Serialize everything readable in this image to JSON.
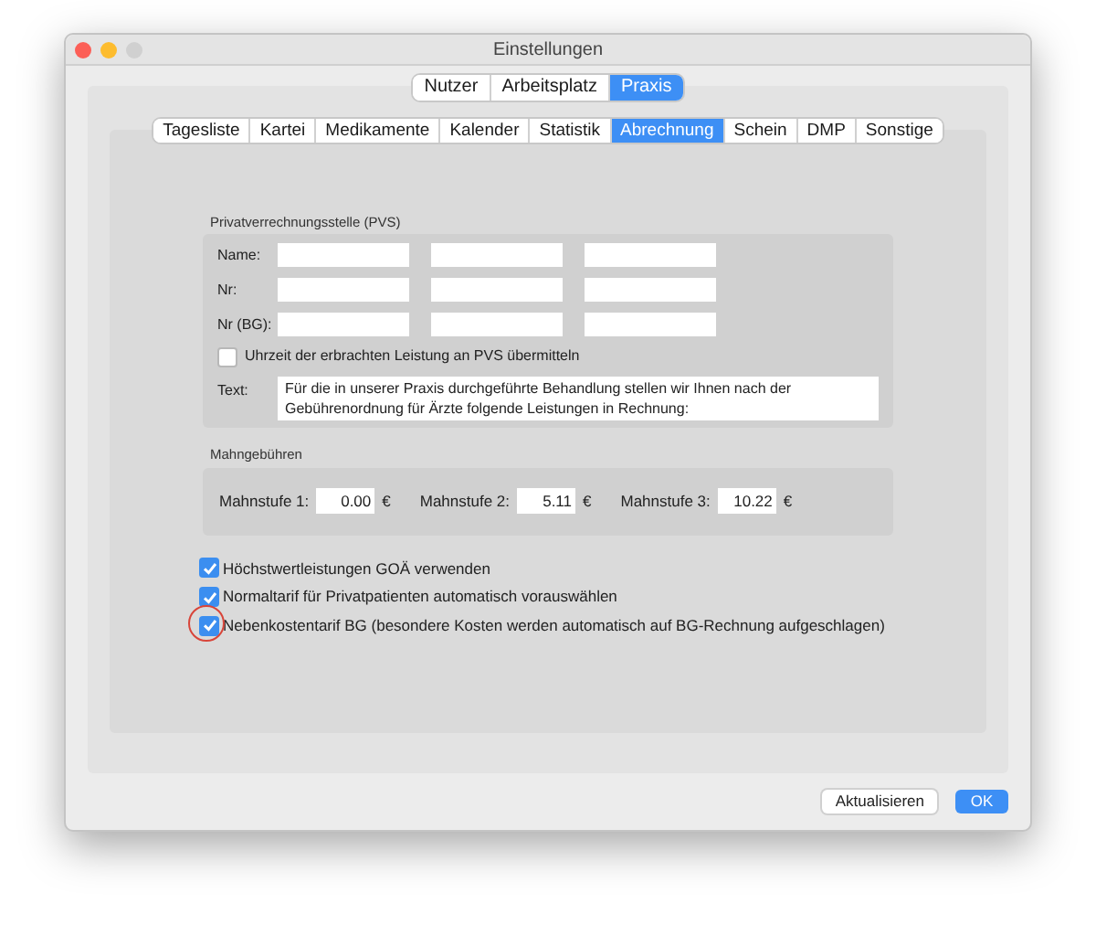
{
  "window": {
    "title": "Einstellungen"
  },
  "main_tabs": [
    {
      "label": "Nutzer",
      "selected": false
    },
    {
      "label": "Arbeitsplatz",
      "selected": false
    },
    {
      "label": "Praxis",
      "selected": true
    }
  ],
  "sub_tabs": [
    {
      "label": "Tagesliste",
      "selected": false
    },
    {
      "label": "Kartei",
      "selected": false
    },
    {
      "label": "Medikamente",
      "selected": false
    },
    {
      "label": "Kalender",
      "selected": false
    },
    {
      "label": "Statistik",
      "selected": false
    },
    {
      "label": "Abrechnung",
      "selected": true
    },
    {
      "label": "Schein",
      "selected": false
    },
    {
      "label": "DMP",
      "selected": false
    },
    {
      "label": "Sonstige",
      "selected": false
    }
  ],
  "pvs": {
    "title": "Privatverrechnungsstelle (PVS)",
    "rows": [
      {
        "label": "Name:"
      },
      {
        "label": "Nr:"
      },
      {
        "label": "Nr (BG):"
      }
    ],
    "time_checkbox": {
      "label": "Uhrzeit der erbrachten Leistung an PVS übermitteln",
      "checked": false
    },
    "text_label": "Text:",
    "text_value": "Für die in unserer Praxis durchgeführte Behandlung stellen wir Ihnen nach der Gebührenordnung für Ärzte folgende Leistungen in Rechnung:"
  },
  "dunning": {
    "title": "Mahngebühren",
    "levels": [
      {
        "label": "Mahnstufe 1:",
        "value": "0.00",
        "currency": "€"
      },
      {
        "label": "Mahnstufe 2:",
        "value": "5.11",
        "currency": "€"
      },
      {
        "label": "Mahnstufe 3:",
        "value": "10.22",
        "currency": "€"
      }
    ]
  },
  "options": [
    {
      "label": "Höchstwertleistungen GOÄ verwenden",
      "checked": true,
      "highlighted": false
    },
    {
      "label": "Normaltarif für Privatpatienten automatisch vorauswählen",
      "checked": true,
      "highlighted": false
    },
    {
      "label": "Nebenkostentarif BG (besondere Kosten werden automatisch auf BG-Rechnung aufgeschlagen)",
      "checked": true,
      "highlighted": true
    }
  ],
  "buttons": [
    {
      "label": "Aktualisieren",
      "kind": "secondary"
    },
    {
      "label": "OK",
      "kind": "primary"
    }
  ]
}
